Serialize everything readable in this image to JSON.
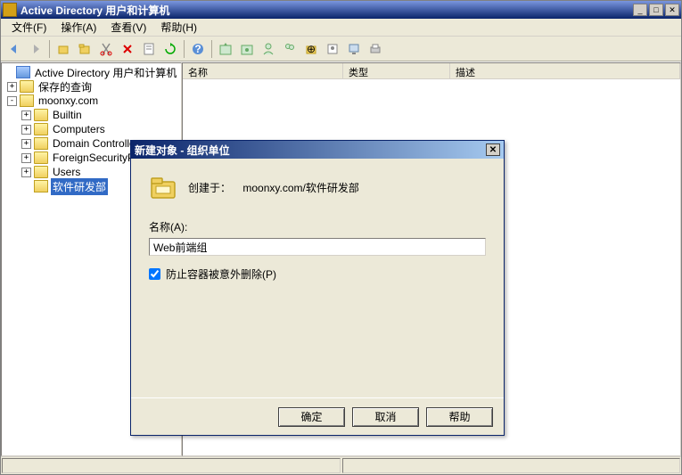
{
  "window": {
    "title": "Active Directory 用户和计算机"
  },
  "menu": {
    "file": "文件(F)",
    "action": "操作(A)",
    "view": "查看(V)",
    "help": "帮助(H)"
  },
  "tree": {
    "root": "Active Directory 用户和计算机",
    "saved": "保存的查询",
    "domain": "moonxy.com",
    "builtin": "Builtin",
    "computers": "Computers",
    "domain_controllers": "Domain Controllers",
    "foreign": "ForeignSecurityPrincipals",
    "users": "Users",
    "dept": "软件研发部"
  },
  "list": {
    "col_name": "名称",
    "col_type": "类型",
    "col_desc": "描述"
  },
  "dialog": {
    "title": "新建对象 - 组织单位",
    "created_in_label": "创建于：",
    "created_in_value": "moonxy.com/软件研发部",
    "name_label": "名称(A):",
    "name_value": "Web前端组",
    "protect_label": "防止容器被意外删除(P)",
    "protect_checked": true,
    "ok": "确定",
    "cancel": "取消",
    "help": "帮助"
  }
}
